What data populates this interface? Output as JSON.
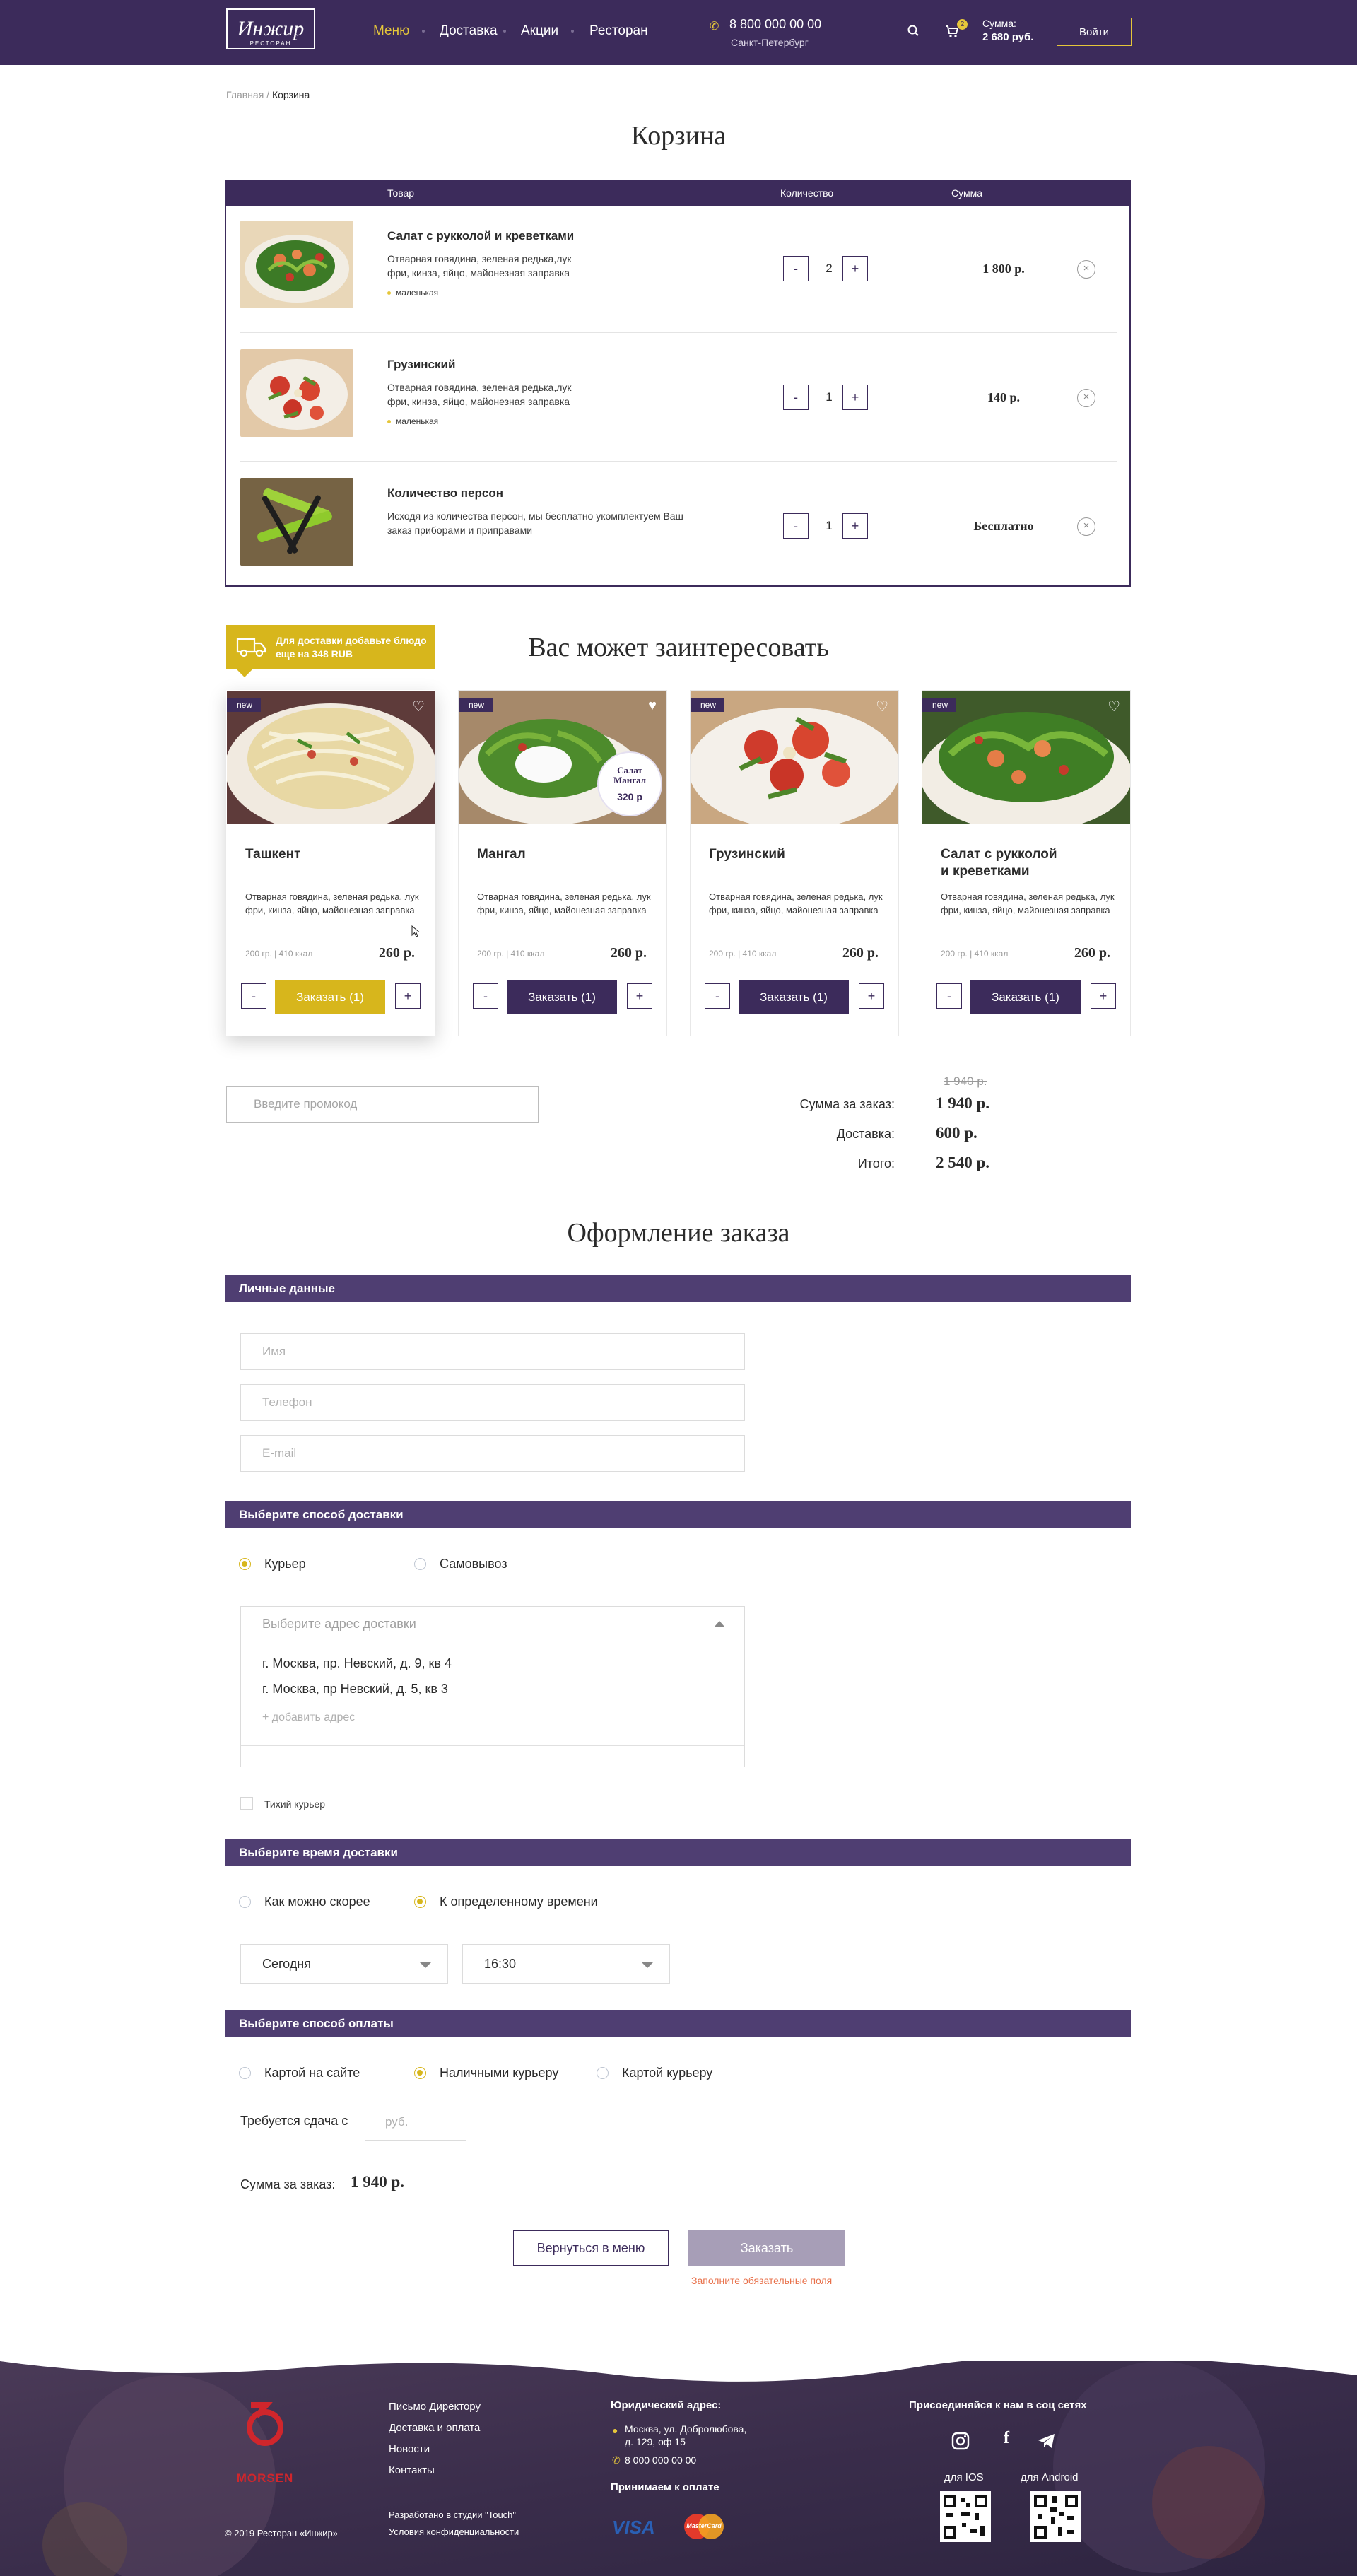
{
  "header": {
    "logo_text": "Инжир",
    "logo_sub": "РЕСТОРАН",
    "nav": [
      "Меню",
      "Доставка",
      "Акции",
      "Ресторан"
    ],
    "phone": "8 800 000 00 00",
    "city": "Санкт-Петербург",
    "cart_count": "2",
    "sum_label": "Сумма:",
    "sum_value": "2 680 руб.",
    "login": "Войти"
  },
  "breadcrumb": {
    "home": "Главная",
    "sep": " / ",
    "current": "Корзина"
  },
  "cart": {
    "title": "Корзина",
    "columns": {
      "product": "Товар",
      "qty": "Количество",
      "sum": "Сумма"
    },
    "items": [
      {
        "name": "Салат с рукколой и креветками",
        "desc": "Отварная говядина, зеленая редька,лук фри, кинза, яйцо, майонезная заправка",
        "tag": "маленькая",
        "qty": "2",
        "price": "1 800 р."
      },
      {
        "name": "Грузинский",
        "desc": "Отварная говядина, зеленая редька,лук фри, кинза, яйцо, майонезная заправка",
        "tag": "маленькая",
        "qty": "1",
        "price": "140 р."
      },
      {
        "name": "Количество персон",
        "desc": "Исходя из количества персон, мы бесплатно укомплектуем Ваш заказ приборами и приправами",
        "tag": "",
        "qty": "1",
        "price": "Бесплатно"
      }
    ],
    "minus": "-",
    "plus": "+",
    "remove": "×"
  },
  "delivery_badge": {
    "line1": "Для доставки добавьте блюдо",
    "line2": "еще на 348 RUB"
  },
  "recommend": {
    "title": "Вас может заинтересовать",
    "new_label": "new",
    "order_label": "Заказать (1)",
    "cards": [
      {
        "name": "Ташкент",
        "desc": "Отварная говядина, зеленая редька, лук фри, кинза, яйцо, майонезная заправка",
        "weight": "200 гр. | 410 ккал",
        "price": "260 р."
      },
      {
        "name": "Мангал",
        "desc": "Отварная говядина, зеленая редька, лук фри, кинза, яйцо, майонезная заправка",
        "weight": "200 гр. | 410 ккал",
        "price": "260 р.",
        "sticker": [
          "Салат",
          "Мангал",
          "320 р"
        ]
      },
      {
        "name": "Грузинский",
        "desc": "Отварная говядина, зеленая редька, лук фри, кинза, яйцо, майонезная заправка",
        "weight": "200 гр. | 410 ккал",
        "price": "260 р."
      },
      {
        "name": "Салат с рукколой и креветками",
        "desc": "Отварная говядина, зеленая редька, лук фри, кинза, яйцо, майонезная заправка",
        "weight": "200 гр. | 410 ккал",
        "price": "260 р."
      }
    ]
  },
  "promo": {
    "placeholder": "Введите промокод"
  },
  "totals": {
    "old": "1 940 р.",
    "order_label": "Сумма за заказ:",
    "order_value": "1 940 р.",
    "delivery_label": "Доставка:",
    "delivery_value": "600 р.",
    "total_label": "Итого:",
    "total_value": "2 540 р."
  },
  "checkout": {
    "title": "Оформление заказа",
    "personal": {
      "header": "Личные данные",
      "name_ph": "Имя",
      "phone_ph": "Телефон",
      "email_ph": "E-mail"
    },
    "delivery": {
      "header": "Выберите способ доставки",
      "options": [
        "Курьер",
        "Самовывоз"
      ],
      "address_ph": "Выберите адрес доставки",
      "addresses": [
        "г. Москва, пр. Невский, д. 9, кв 4",
        "г. Москва, пр Невский, д. 5, кв 3"
      ],
      "add_address": "+ добавить адрес",
      "quiet": "Тихий курьер"
    },
    "time": {
      "header": "Выберите время доставки",
      "options": [
        "Как можно скорее",
        "К определенному времени"
      ],
      "day": "Сегодня",
      "hour": "16:30"
    },
    "payment": {
      "header": "Выберите способ оплаты",
      "options": [
        "Картой на сайте",
        "Наличными курьеру",
        "Картой курьеру"
      ],
      "change_label": "Требуется сдача с",
      "change_ph": "руб."
    },
    "sum_label": "Сумма за заказ:",
    "sum_value": "1 940 р.",
    "back": "Вернуться в меню",
    "submit": "Заказать",
    "required": "Заполните обязательные поля"
  },
  "footer": {
    "brand": "MORSEN",
    "copyright": "© 2019 Ресторан «Инжир»",
    "links": [
      "Письмо Директору",
      "Доставка и оплата",
      "Новости",
      "Контакты"
    ],
    "studio": "Разработано в студии \"Touch\"",
    "privacy": "Условия конфиденциальности",
    "legal_title": "Юридический адрес:",
    "address1": "Москва, ул. Добролюбова,",
    "address2": "д. 129, оф 15",
    "phone": "8 000 000 00 00",
    "pay_title": "Принимаем к оплате",
    "visa": "VISA",
    "mastercard": "MasterCard",
    "social_title": "Присоединяйся к нам в соц сетях",
    "ios": "для IOS",
    "android": "для Android"
  },
  "colors": {
    "brand": "#3c2b5b",
    "accent": "#d7b61c",
    "error": "#e8704a"
  }
}
